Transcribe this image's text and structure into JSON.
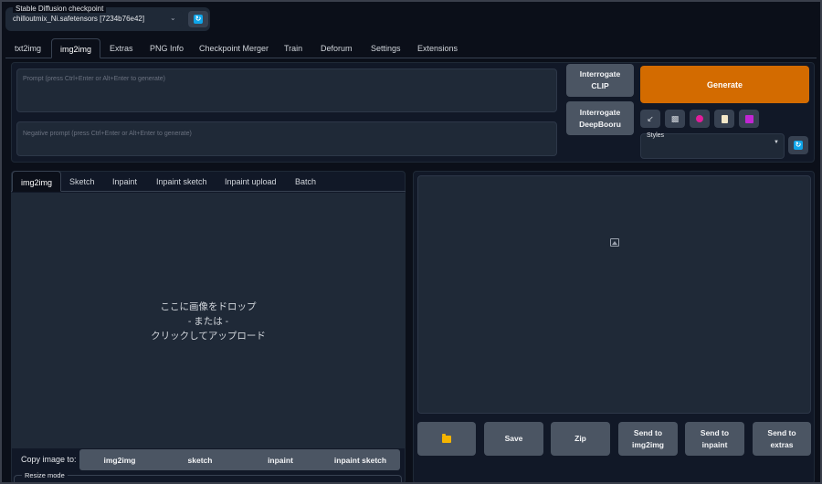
{
  "checkpoint": {
    "label": "Stable Diffusion checkpoint",
    "value": "chilloutmix_Ni.safetensors [7234b76e42]"
  },
  "main_tabs": [
    {
      "label": "txt2img"
    },
    {
      "label": "img2img",
      "active": true
    },
    {
      "label": "Extras"
    },
    {
      "label": "PNG Info"
    },
    {
      "label": "Checkpoint Merger"
    },
    {
      "label": "Train"
    },
    {
      "label": "Deforum"
    },
    {
      "label": "Settings"
    },
    {
      "label": "Extensions"
    }
  ],
  "prompt": {
    "placeholder": "Prompt (press Ctrl+Enter or Alt+Enter to generate)",
    "value": ""
  },
  "negative_prompt": {
    "placeholder": "Negative prompt (press Ctrl+Enter or Alt+Enter to generate)",
    "value": ""
  },
  "buttons": {
    "interrogate_clip": "Interrogate CLIP",
    "interrogate_deepbooru": "Interrogate DeepBooru",
    "generate": "Generate"
  },
  "tool_icons": [
    "arrow-icon",
    "trash-icon",
    "art-palette-icon",
    "clipboard-icon",
    "save-disk-icon"
  ],
  "styles": {
    "label": "Styles",
    "value": ""
  },
  "sub_tabs": [
    {
      "label": "img2img",
      "active": true
    },
    {
      "label": "Sketch"
    },
    {
      "label": "Inpaint"
    },
    {
      "label": "Inpaint sketch"
    },
    {
      "label": "Inpaint upload"
    },
    {
      "label": "Batch"
    }
  ],
  "drop_zone": {
    "line1": "ここに画像をドロップ",
    "line2": "- または -",
    "line3": "クリックしてアップロード"
  },
  "copy_image": {
    "label": "Copy image to:",
    "targets": [
      "img2img",
      "sketch",
      "inpaint",
      "inpaint sketch"
    ]
  },
  "resize_mode": {
    "label": "Resize mode"
  },
  "output_buttons": {
    "save": "Save",
    "zip": "Zip",
    "send_img2img_1": "Send to",
    "send_img2img_2": "img2img",
    "send_inpaint_1": "Send to",
    "send_inpaint_2": "inpaint",
    "send_extras_1": "Send to",
    "send_extras_2": "extras"
  },
  "colors": {
    "background": "#0b0f19",
    "panel": "#111827",
    "input": "#1f2937",
    "button": "#4b5563",
    "accent": "#d36b00",
    "folder": "#f5b400",
    "refresh": "#0ea5e9"
  }
}
